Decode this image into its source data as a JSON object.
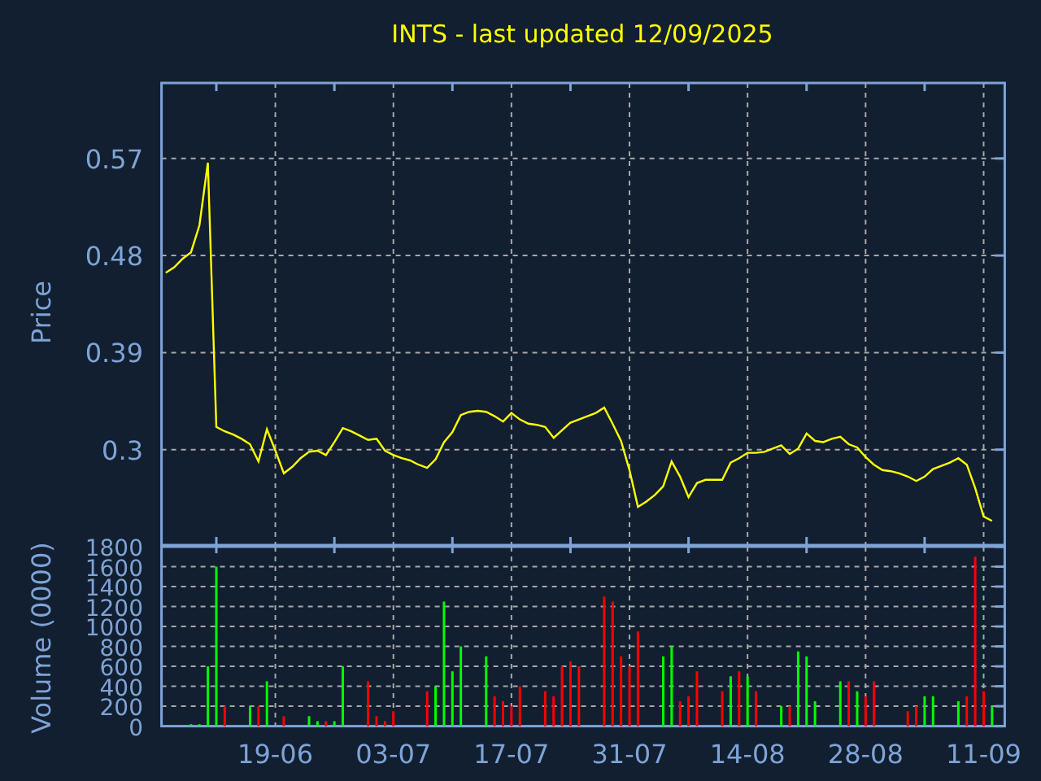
{
  "title": "INTS - last updated 12/09/2025",
  "price_chart": {
    "chart_data": {
      "type": "line",
      "ylabel": "Price",
      "grid": true,
      "ylim": [
        0.2115,
        0.64
      ],
      "yticks": [
        {
          "value": 0.3,
          "label": "0.3"
        },
        {
          "value": 0.39,
          "label": "0.39"
        },
        {
          "value": 0.48,
          "label": "0.48"
        },
        {
          "value": 0.57,
          "label": "0.57"
        }
      ],
      "categories": [
        null,
        null,
        null,
        null,
        null,
        null,
        null,
        null,
        null,
        null,
        null,
        null,
        null,
        null,
        null,
        null,
        null,
        null,
        null,
        null,
        null,
        null,
        null,
        null,
        null,
        null,
        null,
        null,
        null,
        null,
        null,
        null,
        null,
        null,
        null,
        null,
        null,
        null,
        null,
        null,
        null,
        null,
        null,
        null,
        null,
        null,
        null,
        null,
        null,
        null,
        null,
        null,
        null,
        null,
        null,
        null,
        null,
        null,
        null,
        null,
        null,
        null,
        null,
        null,
        null,
        null,
        null,
        null,
        null,
        null,
        null,
        null,
        null,
        null,
        null,
        null,
        null,
        null,
        null,
        null,
        null,
        null,
        null,
        null,
        null,
        null,
        null,
        null,
        null,
        null,
        null,
        null,
        null,
        null,
        null,
        null,
        null,
        null,
        null,
        null
      ],
      "series": [
        {
          "color": "#ffff00",
          "values": [
            0.464,
            0.469,
            0.477,
            0.483,
            0.508,
            0.566,
            0.321,
            0.317,
            0.314,
            0.31,
            0.305,
            0.289,
            0.319,
            0.299,
            0.278,
            0.284,
            0.292,
            0.298,
            0.299,
            0.295,
            0.307,
            0.32,
            0.317,
            0.313,
            0.309,
            0.31,
            0.299,
            0.295,
            0.292,
            0.29,
            0.286,
            0.283,
            0.291,
            0.307,
            0.316,
            0.332,
            0.335,
            0.336,
            0.335,
            0.331,
            0.326,
            0.334,
            0.328,
            0.324,
            0.323,
            0.321,
            0.311,
            0.318,
            0.325,
            0.328,
            0.331,
            0.334,
            0.339,
            0.324,
            0.308,
            0.281,
            0.247,
            0.252,
            0.258,
            0.266,
            0.289,
            0.275,
            0.256,
            0.269,
            0.272,
            0.272,
            0.272,
            0.288,
            0.292,
            0.297,
            0.297,
            0.298,
            0.301,
            0.304,
            0.296,
            0.301,
            0.315,
            0.308,
            0.307,
            0.31,
            0.312,
            0.305,
            0.302,
            0.293,
            0.286,
            0.281,
            0.28,
            0.278,
            0.275,
            0.271,
            0.275,
            0.282,
            0.285,
            0.288,
            0.292,
            0.286,
            0.264,
            0.238,
            0.234,
            null
          ]
        }
      ]
    }
  },
  "volume_chart": {
    "chart_data": {
      "type": "bar",
      "ylabel": "Volume (0000)",
      "grid": true,
      "ylim": [
        0,
        1800
      ],
      "yticks": [
        0,
        200,
        400,
        600,
        800,
        1000,
        1200,
        1400,
        1600,
        1800
      ],
      "categories": [
        null,
        null,
        null,
        null,
        null,
        null,
        null,
        null,
        null,
        null,
        null,
        null,
        null,
        "19-06",
        null,
        null,
        null,
        null,
        null,
        null,
        null,
        null,
        null,
        null,
        null,
        null,
        null,
        "03-07",
        null,
        null,
        null,
        null,
        null,
        null,
        null,
        null,
        null,
        null,
        null,
        null,
        null,
        "17-07",
        null,
        null,
        null,
        null,
        null,
        null,
        null,
        null,
        null,
        null,
        null,
        null,
        null,
        "31-07",
        null,
        null,
        null,
        null,
        null,
        null,
        null,
        null,
        null,
        null,
        null,
        null,
        null,
        "14-08",
        null,
        null,
        null,
        null,
        null,
        null,
        null,
        null,
        null,
        null,
        null,
        null,
        null,
        "28-08",
        null,
        null,
        null,
        null,
        null,
        null,
        null,
        null,
        null,
        null,
        null,
        null,
        null,
        "11-09",
        null,
        null
      ],
      "series": [
        {
          "color": "#00ff00",
          "values": [
            null,
            null,
            null,
            20,
            20,
            600,
            1600,
            null,
            null,
            null,
            200,
            null,
            450,
            null,
            null,
            null,
            null,
            100,
            50,
            null,
            50,
            600,
            null,
            null,
            null,
            null,
            null,
            null,
            null,
            null,
            null,
            null,
            400,
            1250,
            550,
            800,
            null,
            null,
            700,
            null,
            null,
            null,
            null,
            null,
            null,
            null,
            null,
            null,
            null,
            null,
            null,
            null,
            null,
            null,
            null,
            null,
            null,
            null,
            null,
            700,
            800,
            null,
            null,
            null,
            null,
            null,
            null,
            500,
            null,
            500,
            null,
            null,
            null,
            200,
            null,
            750,
            700,
            250,
            null,
            null,
            450,
            null,
            350,
            null,
            null,
            null,
            null,
            null,
            null,
            null,
            300,
            300,
            null,
            null,
            250,
            null,
            null,
            null,
            200,
            null
          ]
        },
        {
          "color": "#ff0000",
          "values": [
            null,
            null,
            null,
            null,
            null,
            null,
            null,
            200,
            null,
            null,
            null,
            200,
            null,
            null,
            100,
            null,
            null,
            null,
            null,
            50,
            null,
            null,
            null,
            null,
            450,
            100,
            50,
            150,
            null,
            null,
            null,
            350,
            null,
            null,
            null,
            null,
            null,
            null,
            null,
            300,
            250,
            200,
            400,
            null,
            null,
            350,
            300,
            600,
            650,
            600,
            null,
            null,
            1300,
            1250,
            700,
            600,
            950,
            null,
            null,
            null,
            null,
            250,
            300,
            550,
            null,
            null,
            350,
            null,
            550,
            null,
            350,
            null,
            null,
            null,
            200,
            null,
            null,
            null,
            null,
            null,
            null,
            450,
            null,
            300,
            450,
            null,
            null,
            null,
            150,
            200,
            null,
            null,
            null,
            null,
            null,
            300,
            1700,
            350,
            null,
            null
          ]
        }
      ]
    }
  }
}
